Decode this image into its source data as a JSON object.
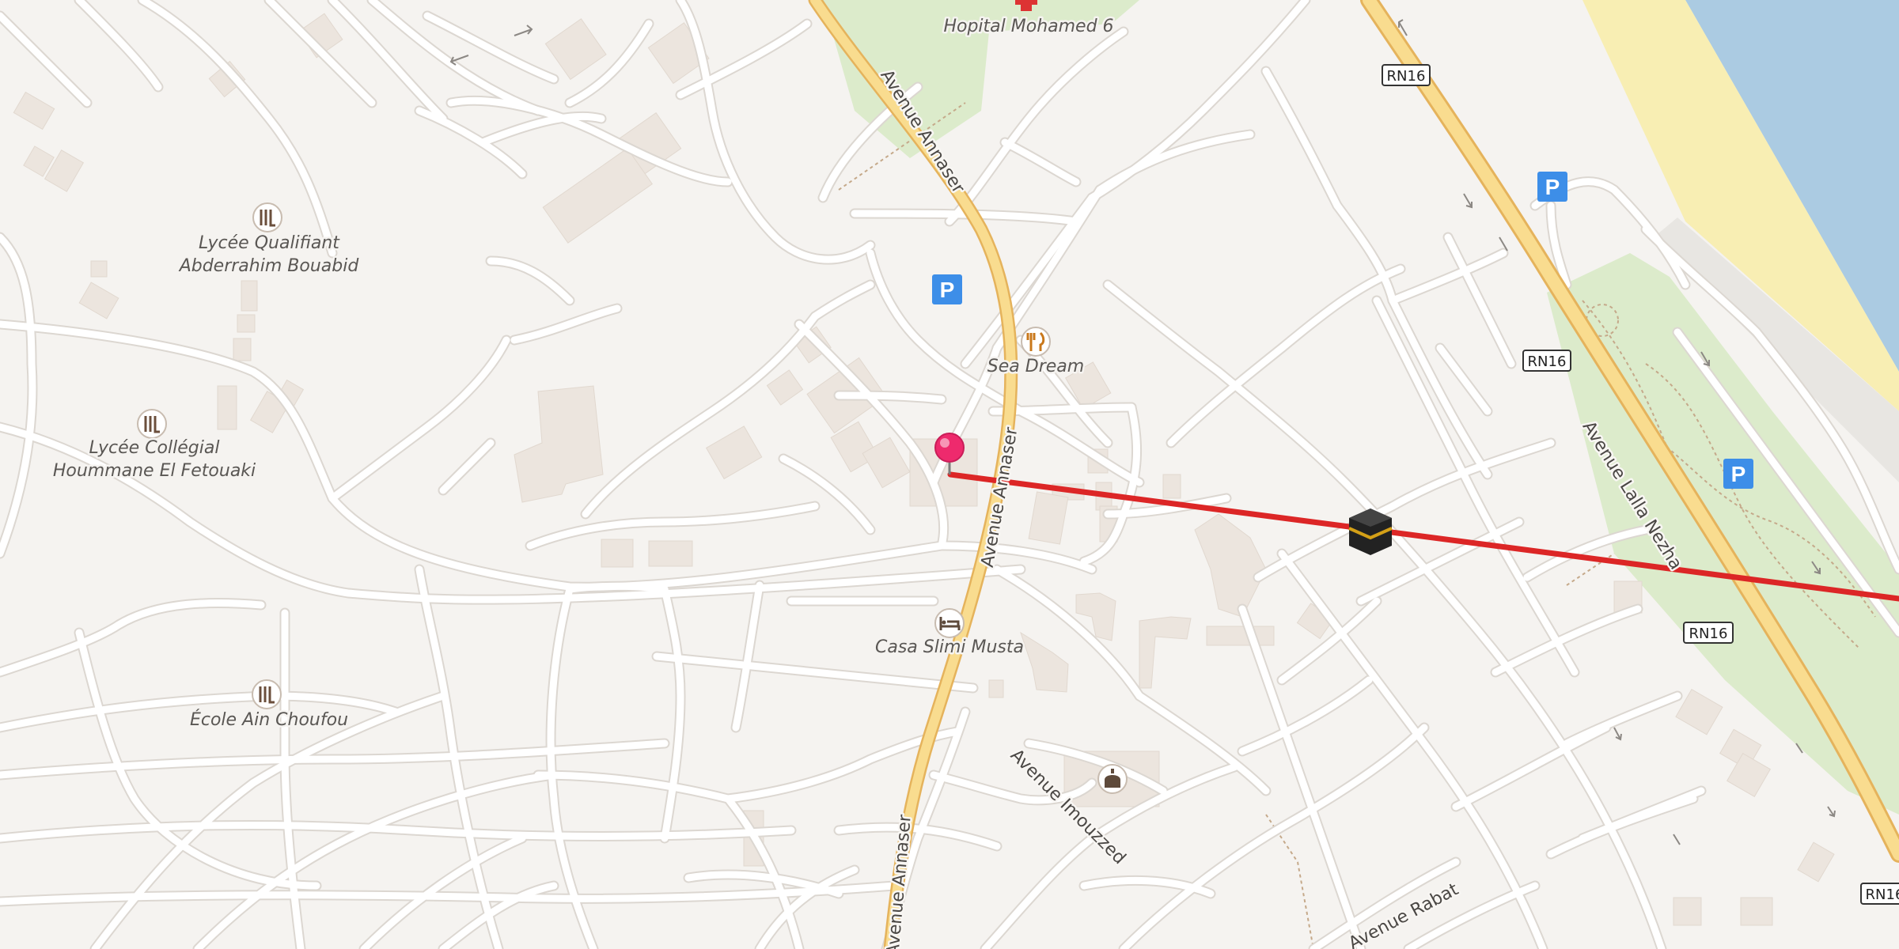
{
  "map": {
    "poi_labels": {
      "hospital": "Hopital Mohamed 6",
      "lycee_qualifiant_l1": "Lycée Qualifiant",
      "lycee_qualifiant_l2": "Abderrahim Bouabid",
      "lycee_college_l1": "Lycée Collégial",
      "lycee_college_l2": "Hoummane El Fetouaki",
      "ecole": "École Ain Choufou",
      "restaurant": "Sea Dream",
      "hotel": "Casa Slimi Musta"
    },
    "street_labels": {
      "annaser_north": "Avenue Annaser",
      "annaser_middle": "Avenue Annaser",
      "annaser_south": "Avenue Annaser",
      "imouzzed": "Avenue Imouzzed",
      "rabat": "Avenue Rabat",
      "lalla_nezha": "Avenue Lalla Nezha"
    },
    "road_shields": [
      "RN16",
      "RN16",
      "RN16",
      "RN16"
    ],
    "parking_label": "P",
    "icons": {
      "pin": "location-pin-icon",
      "kaaba": "kaaba-qibla-icon",
      "hospital": "hospital-cross-icon",
      "school": "school-icon",
      "restaurant": "restaurant-icon",
      "hotel": "hotel-bed-icon",
      "mosque": "mosque-icon",
      "parking": "parking-icon"
    },
    "colors": {
      "land": "#f5f3f0",
      "road": "#ffffff",
      "road_edge": "#dcd7d1",
      "primary_road": "#f9dc8f",
      "primary_road_edge": "#e5b35c",
      "park": "#dcebcb",
      "beach": "#f8eeb3",
      "sea": "#abcbe2",
      "building": "#ece5de",
      "qibla_line": "#dc2626",
      "pin": "#ee2a6d",
      "parking": "#3d8ee8"
    }
  }
}
